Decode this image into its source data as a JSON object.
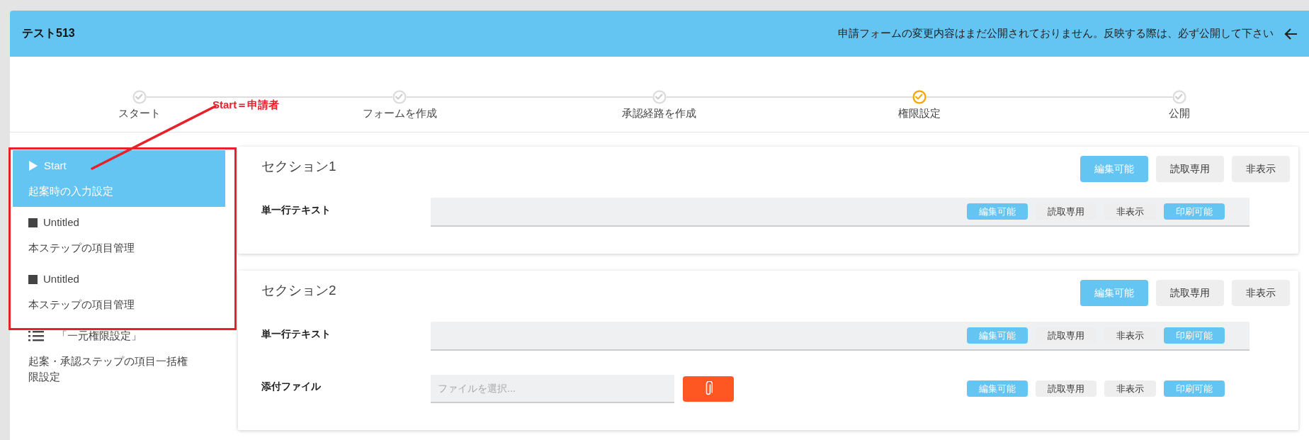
{
  "header": {
    "title": "テスト513",
    "notice": "申請フォームの変更内容はまだ公開されておりません。反映する際は、必ず公開して下さい"
  },
  "steps": [
    {
      "label": "スタート",
      "selected": false
    },
    {
      "label": "フォームを作成",
      "selected": false
    },
    {
      "label": "承認経路を作成",
      "selected": false
    },
    {
      "label": "権限設定",
      "selected": true
    },
    {
      "label": "公開",
      "selected": false
    }
  ],
  "annotation": {
    "label": "Start＝申請者"
  },
  "sidebar": {
    "items": [
      {
        "kind": "start",
        "title": "Start",
        "description": "起案時の入力設定",
        "selected": true
      },
      {
        "kind": "step",
        "title": "Untitled",
        "description": "本ステップの項目管理",
        "selected": false
      },
      {
        "kind": "step",
        "title": "Untitled",
        "description": "本ステップの項目管理",
        "selected": false
      },
      {
        "kind": "bulk",
        "title": "「一元権限設定」",
        "description": "起案・承認ステップの項目一括権限設定",
        "selected": false
      }
    ]
  },
  "sections": [
    {
      "title": "セクション1",
      "modes": [
        {
          "label": "編集可能",
          "selected": true
        },
        {
          "label": "読取専用",
          "selected": false
        },
        {
          "label": "非表示",
          "selected": false
        }
      ],
      "fields": [
        {
          "kind": "text",
          "label": "単一行テキスト",
          "modes": [
            {
              "label": "編集可能",
              "selected": true
            },
            {
              "label": "読取専用",
              "selected": false
            },
            {
              "label": "非表示",
              "selected": false
            },
            {
              "label": "印刷可能",
              "selected": true
            }
          ]
        }
      ]
    },
    {
      "title": "セクション2",
      "modes": [
        {
          "label": "編集可能",
          "selected": true
        },
        {
          "label": "読取専用",
          "selected": false
        },
        {
          "label": "非表示",
          "selected": false
        }
      ],
      "fields": [
        {
          "kind": "text",
          "label": "単一行テキスト",
          "modes": [
            {
              "label": "編集可能",
              "selected": true
            },
            {
              "label": "読取専用",
              "selected": false
            },
            {
              "label": "非表示",
              "selected": false
            },
            {
              "label": "印刷可能",
              "selected": true
            }
          ]
        },
        {
          "kind": "file",
          "label": "添付ファイル",
          "placeholder": "ファイルを選択...",
          "modes": [
            {
              "label": "編集可能",
              "selected": true
            },
            {
              "label": "読取専用",
              "selected": false
            },
            {
              "label": "非表示",
              "selected": false
            },
            {
              "label": "印刷可能",
              "selected": true
            }
          ]
        }
      ]
    }
  ]
}
